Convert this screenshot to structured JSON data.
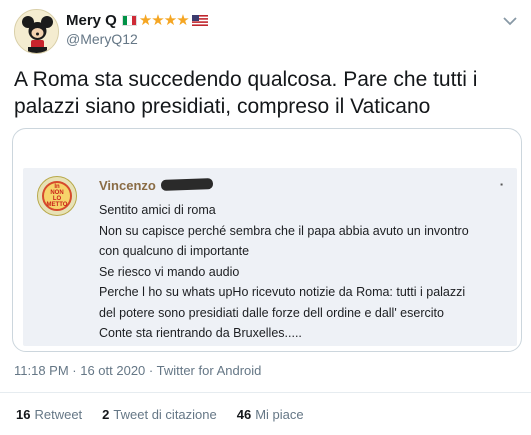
{
  "user": {
    "display_name": "Mery Q",
    "handle": "@MeryQ12",
    "badges": [
      "flag-italy",
      "star",
      "star",
      "star",
      "star",
      "flag-usa"
    ],
    "stars": "★★★★"
  },
  "tweet": {
    "text": "A Roma sta succedendo qualcosa. Pare che tutti i palazzi siano presidiati, compreso il Vaticano"
  },
  "embedded_post": {
    "author": "Vincenzo",
    "avatar_text": [
      "In",
      "Movimento",
      "all'aperto",
      "NON",
      "LO",
      "METTO"
    ],
    "lines": [
      "Sentito amici di roma",
      "Non su capisce perché sembra che il papa abbia avuto un invontro",
      "con qualcuno di importante",
      "Se riesco vi mando audio",
      "Perche l ho su whats upHo ricevuto notizie da Roma: tutti i palazzi",
      "del potere sono presidiati dalle forze dell ordine e dall' esercito",
      "Conte sta rientrando da Bruxelles....."
    ]
  },
  "meta": {
    "timestamp": "11:18 PM · 16 ott 2020 · Twitter for Android"
  },
  "stats": {
    "retweets_count": "16",
    "retweets_label": "Retweet",
    "quotes_count": "2",
    "quotes_label": "Tweet di citazione",
    "likes_count": "46",
    "likes_label": "Mi piace"
  },
  "colors": {
    "text_primary": "#14171a",
    "text_secondary": "#657786",
    "border": "#ccd6dd",
    "star": "#f5a623"
  },
  "icons": {
    "menu": "chevron-down-icon"
  }
}
